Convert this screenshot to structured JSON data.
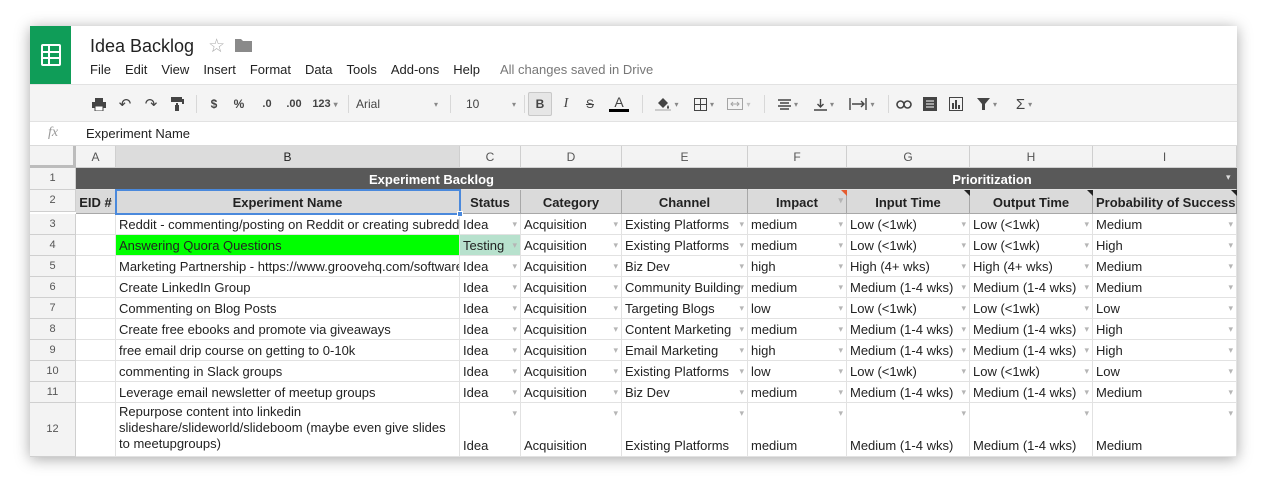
{
  "doc": {
    "title": "Idea Backlog",
    "star_icon": "star-icon",
    "folder_icon": "folder-icon"
  },
  "menu": {
    "items": [
      "File",
      "Edit",
      "View",
      "Insert",
      "Format",
      "Data",
      "Tools",
      "Add-ons",
      "Help"
    ],
    "save_status": "All changes saved in Drive"
  },
  "toolbar": {
    "currency": "$",
    "percent": "%",
    "dec_decrease": ".0",
    "dec_increase": ".00",
    "more_formats": "123",
    "font": "Arial",
    "font_size": "10",
    "bold": "B",
    "italic": "I",
    "strike": "S",
    "text_color": "A"
  },
  "formula_bar": {
    "fx_label": "fx",
    "value": "Experiment Name"
  },
  "columns": [
    "A",
    "B",
    "C",
    "D",
    "E",
    "F",
    "G",
    "H",
    "I"
  ],
  "row_numbers": [
    "1",
    "2",
    "3",
    "4",
    "5",
    "6",
    "7",
    "8",
    "9",
    "10",
    "11",
    "12"
  ],
  "group_headers": {
    "left": "Experiment Backlog",
    "right": "Prioritization"
  },
  "headers": [
    "EID #",
    "Experiment Name",
    "Status",
    "Category",
    "Channel",
    "Impact",
    "Input Time",
    "Output Time",
    "Probability of Success"
  ],
  "rows": [
    [
      "",
      "Reddit - commenting/posting on Reddit or creating subreddit",
      "Idea",
      "Acquisition",
      "Existing Platforms",
      "medium",
      "Low (<1wk)",
      "Low (<1wk)",
      "Medium"
    ],
    [
      "",
      "Answering Quora Questions",
      "Testing",
      "Acquisition",
      "Existing Platforms",
      "medium",
      "Low (<1wk)",
      "Low (<1wk)",
      "High"
    ],
    [
      "",
      "Marketing Partnership - https://www.groovehq.com/software",
      "Idea",
      "Acquisition",
      "Biz Dev",
      "high",
      "High (4+ wks)",
      "High (4+ wks)",
      "Medium"
    ],
    [
      "",
      "Create LinkedIn Group",
      "Idea",
      "Acquisition",
      "Community Building",
      "medium",
      "Medium (1-4 wks)",
      "Medium (1-4 wks)",
      "Medium"
    ],
    [
      "",
      "Commenting on Blog Posts",
      "Idea",
      "Acquisition",
      "Targeting Blogs",
      "low",
      "Low (<1wk)",
      "Low (<1wk)",
      "Low"
    ],
    [
      "",
      "Create free ebooks and promote via giveaways",
      "Idea",
      "Acquisition",
      "Content Marketing",
      "medium",
      "Medium (1-4 wks)",
      "Medium (1-4 wks)",
      "High"
    ],
    [
      "",
      "free email drip course on getting to 0-10k",
      "Idea",
      "Acquisition",
      "Email Marketing",
      "high",
      "Medium (1-4 wks)",
      "Medium (1-4 wks)",
      "High"
    ],
    [
      "",
      "commenting in Slack groups",
      "Idea",
      "Acquisition",
      "Existing Platforms",
      "low",
      "Low (<1wk)",
      "Low (<1wk)",
      "Low"
    ],
    [
      "",
      "Leverage email newsletter of meetup groups",
      "Idea",
      "Acquisition",
      "Biz Dev",
      "medium",
      "Medium (1-4 wks)",
      "Medium (1-4 wks)",
      "Medium"
    ],
    [
      "",
      "Repurpose content into linkedin slideshare/slideworld/slideboom (maybe even give slides to meetupgroups)",
      "Idea",
      "Acquisition",
      "Existing Platforms",
      "medium",
      "Medium (1-4 wks)",
      "Medium (1-4 wks)",
      "Medium"
    ]
  ],
  "colors": {
    "brand_green": "#0f9d58",
    "highlight_green": "#00ff00",
    "testing_bg": "#b7e1cd",
    "header_dark": "#595959",
    "selection_blue": "#4a89dc"
  }
}
